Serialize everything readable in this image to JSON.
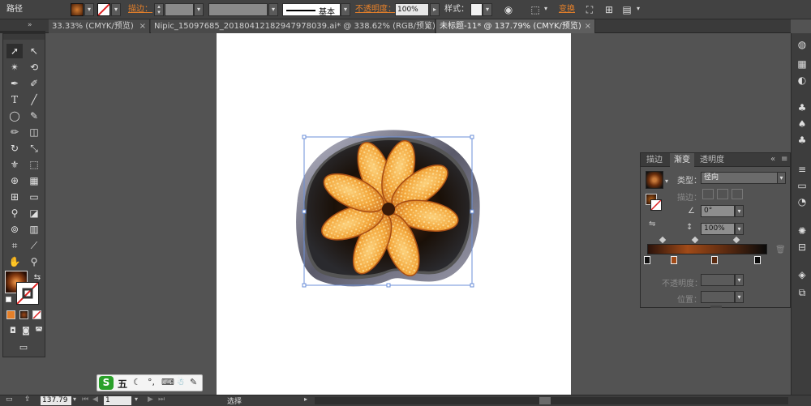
{
  "control_bar": {
    "selection_type": "路径",
    "stroke_label": "描边：",
    "stroke_profile": "基本",
    "opacity_label": "不透明度：",
    "opacity_value": "100%",
    "style_label": "样式：",
    "transform_label": "变换"
  },
  "doc_tabs": [
    {
      "label": "33.33% (CMYK/预览)",
      "close": "×"
    },
    {
      "label": "Nipic_15097685_20180412182947978039.ai* @ 338.62% (RGB/预览)",
      "close": "×"
    },
    {
      "label": "未标题-11* @ 137.79% (CMYK/预览)",
      "close": "×"
    }
  ],
  "tabs_scroll_icon": "»",
  "gradient_panel": {
    "tabs": [
      "描边",
      "渐变",
      "透明度"
    ],
    "type_label": "类型：",
    "type_value": "径向",
    "stroke_label": "描边：",
    "angle_value": "0°",
    "aspect_value": "100%",
    "opacity_label": "不透明度：",
    "position_label": "位置：",
    "gradient_stops": [
      "#2a120a",
      "#a04a18",
      "#5a2a10",
      "#0a0a0a"
    ]
  },
  "status_bar": {
    "zoom": "137.79",
    "page": "1",
    "tool_name": "选择"
  },
  "ime_toolbar": {
    "logo": "S",
    "mode": "五",
    "items": [
      "moon-icon",
      "punctuation-icon",
      "keyboard-icon",
      "user-icon",
      "wrench-icon"
    ]
  },
  "colors": {
    "fill_swatch": "#8a4a1a",
    "orange_accent": "#e5802a",
    "ui_dark": "#424242",
    "canvas": "#535353"
  }
}
